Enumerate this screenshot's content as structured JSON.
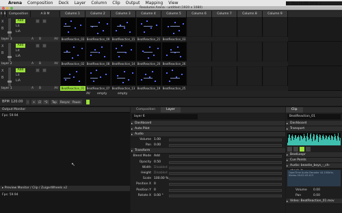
{
  "menubar": {
    "app": "Arena",
    "items": [
      "Composition",
      "Deck",
      "Layer",
      "Column",
      "Clip",
      "Output",
      "Mapping",
      "View"
    ],
    "time": "Thu 11:06",
    "user": "Joris"
  },
  "window": {
    "title": "Resolume Arena - untitled (1920 x 1080)"
  },
  "header": {
    "composition_label": "Composition",
    "columns": [
      "Column 1",
      "Column 2",
      "Column 3",
      "Column 4",
      "Column 5",
      "Column 6",
      "Column 7",
      "Column 8",
      "Column 9"
    ]
  },
  "layers": [
    {
      "name": "layer 3",
      "clips": [
        "BeatReaction_03",
        "BeatReaction_09",
        "BeatReaction_15",
        "BeatReaction_21",
        "BeatReaction_03",
        "",
        "",
        "",
        ""
      ]
    },
    {
      "name": "layer 2",
      "clips": [
        "BeatReaction_02",
        "BeatReaction_08",
        "BeatReaction_14",
        "BeatReaction_20",
        "BeatReaction_26",
        "",
        "",
        "",
        ""
      ]
    },
    {
      "name": "layer 1",
      "clips": [
        "BeatReaction_01",
        "BeatReaction_07",
        "BeatReaction_13",
        "BeatReaction_19",
        "BeatReaction_25",
        "",
        "",
        "",
        ""
      ]
    }
  ],
  "layer_controls": {
    "add_label": "Add",
    "lit_label": "Lit",
    "lia_label": "LiA",
    "a_label": "A",
    "b_label": "B",
    "av_label": "AV",
    "x_label": "X",
    "b2_label": "B"
  },
  "bottom_row": {
    "label1": "AV",
    "label2": "empty",
    "label3": "empty"
  },
  "bpm_bar": {
    "bpm_label": "BPM",
    "bpm_value": "120.00",
    "minus": "-",
    "plus": "+",
    "div": "/2",
    "mul": "*2",
    "tap": "Tap",
    "resync": "Resync",
    "pause": "Pause"
  },
  "output_monitor": {
    "title": "Output Monitor",
    "fps": "Fps: 59.94",
    "preview_title": "Preview Monitor / Clip / ZuigerWheels v2",
    "preview_fps": "Fps: 59.94"
  },
  "mid_panel": {
    "tabs": [
      "Composition",
      "Layer"
    ],
    "active_tab": "Layer",
    "layer_name": "layer 6",
    "sections": {
      "dashboard": "Dashboard",
      "autopilot": "Auto Pilot",
      "audio": "Audio",
      "transform": "Transform"
    },
    "audio_rows": [
      {
        "key": "Volume",
        "value": "1.00"
      },
      {
        "key": "Pan",
        "value": "0.00"
      }
    ],
    "transform_rows": [
      {
        "key": "Blend Mode",
        "value": "Add"
      },
      {
        "key": "Opacity",
        "value": "0.50"
      },
      {
        "key": "Width",
        "value": "Disabled"
      },
      {
        "key": "Height",
        "value": "Disabled"
      },
      {
        "key": "Scale",
        "value": "100.00 %"
      },
      {
        "key": "Position X",
        "value": "0"
      },
      {
        "key": "Position Y",
        "value": "0"
      },
      {
        "key": "Rotate X",
        "value": "0.00 °"
      }
    ]
  },
  "right_panel": {
    "tab": "Clip",
    "clip_name": "BeatReaction_01",
    "dashboard": "Dashboard",
    "transport": "Transport",
    "beatloop": "BeatLoopr",
    "cue_points": "Cue Points",
    "audio_label": "Audio: beastie_boys_-_ch-check_it",
    "audio_info": "OpenTime Audio Decoder 44.100kHz, Stereo 00:02:43.413",
    "volume_key": "Volume",
    "volume_value": "0.00",
    "pan_key": "Pan",
    "pan_value": "0.00",
    "video_label": "Video: BeatReaction_01.mov"
  },
  "colors": {
    "accent_green": "#9ae03a",
    "wave": "#3fbfae"
  }
}
